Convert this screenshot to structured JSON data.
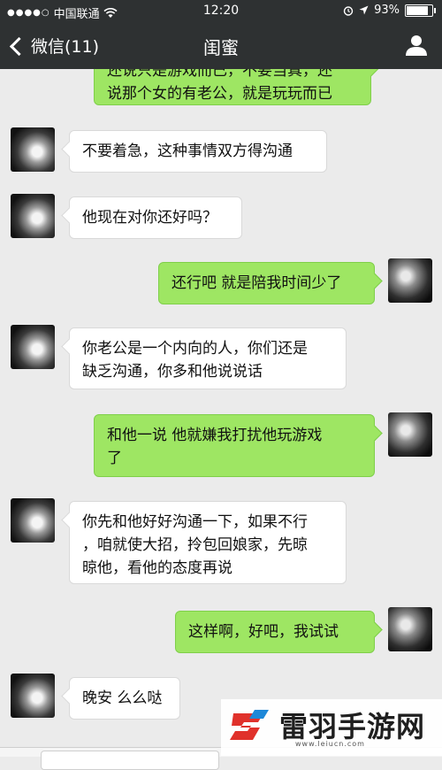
{
  "status_bar": {
    "carrier": "中国联通",
    "time": "12:20",
    "battery": "93%",
    "battery_level": 0.93
  },
  "nav": {
    "back_label": "微信(11)",
    "title": "闺蜜"
  },
  "messages": [
    {
      "side": "out",
      "lines": [
        "还说只是游戏而已，不要当真，还",
        "说那个女的有老公，就是玩玩而已"
      ]
    },
    {
      "side": "in",
      "lines": [
        "不要着急，这种事情双方得沟通"
      ]
    },
    {
      "side": "in",
      "lines": [
        "他现在对你还好吗？"
      ]
    },
    {
      "side": "out",
      "lines": [
        "还行吧 就是陪我时间少了"
      ]
    },
    {
      "side": "in",
      "lines": [
        "你老公是一个内向的人，你们还是",
        "缺乏沟通，你多和他说说话"
      ]
    },
    {
      "side": "out",
      "lines": [
        "和他一说 他就嫌我打扰他玩游戏",
        "了"
      ]
    },
    {
      "side": "in",
      "lines": [
        "你先和他好好沟通一下，如果不行",
        "，咱就使大招，拎包回娘家，先晾",
        "晾他，看他的态度再说"
      ]
    },
    {
      "side": "out",
      "lines": [
        "这样啊，好吧，我试试"
      ]
    },
    {
      "side": "in",
      "lines": [
        "晚安 么么哒"
      ]
    }
  ],
  "watermark": {
    "text": "雷羽手游网",
    "url": "www.leiucn.com",
    "colors": {
      "red": "#e0312b",
      "blue": "#1e88d8"
    }
  }
}
